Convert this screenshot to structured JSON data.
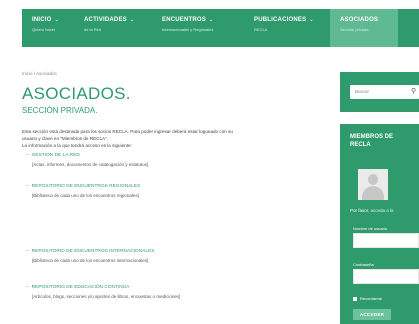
{
  "nav": {
    "items": [
      {
        "label": "INICIO",
        "sub": "Quiero hacer"
      },
      {
        "label": "ACTIVIDADES",
        "sub": "de la Red"
      },
      {
        "label": "ENCUENTROS",
        "sub": "Internacionales y Regionales"
      },
      {
        "label": "PUBLICACIONES",
        "sub": "RECLA"
      },
      {
        "label": "ASOCIADOS",
        "sub": "Sección privada"
      }
    ],
    "active_index": 4,
    "chevron": "⌄"
  },
  "breadcrumb": "Inicio / Asociados",
  "page": {
    "title": "ASOCIADOS.",
    "subtitle": "SECCIÓN PRIVADA.",
    "intro_1": "Esta sección está destinada para los socios RECLA. Para poder ingresar deberá estar logueado con su",
    "intro_2": "usuario y clave en \"Miembros de RECLA\".",
    "intro_3": "La información a la que tendrá acceso es la siguiente:"
  },
  "sections": [
    {
      "title": "GESTIÓN DE LA RED",
      "desc": "[Actas, informes, documentos de catalogación y estatutos]"
    },
    {
      "title": "REPOSITORIO DE ENCUENTROS REGIONALES",
      "desc": "[Biblioteca de cada uno de los encuentros regionales]"
    },
    {
      "title": "REPOSITORIO DE ENCUENTROS INTERNACIONALES",
      "desc": "[Biblioteca de cada uno de los encuentros internacionales]"
    },
    {
      "title": "REPOSITORIO DE EDUCACIÓN CONTINUA",
      "desc": "[Artículos, blogs, secciones y/o aportes de libros, encuestas o mediciones]"
    }
  ],
  "sidebar": {
    "search_placeholder": "Buscar",
    "search_icon": "magnifier-icon",
    "login_title_1": "MIEMBROS DE",
    "login_title_2": "RECLA",
    "note_prefix": "Por favor, ",
    "note_accent": "acceda a la",
    "user_label": "Nombre de usuario",
    "pass_label": "Contraseña",
    "remember_label": "Recordarme",
    "login_button": "ACCEDER"
  },
  "colors": {
    "brand_green": "#2f9a6c",
    "active_tab": "#5fb991",
    "button": "#6cc39c"
  }
}
